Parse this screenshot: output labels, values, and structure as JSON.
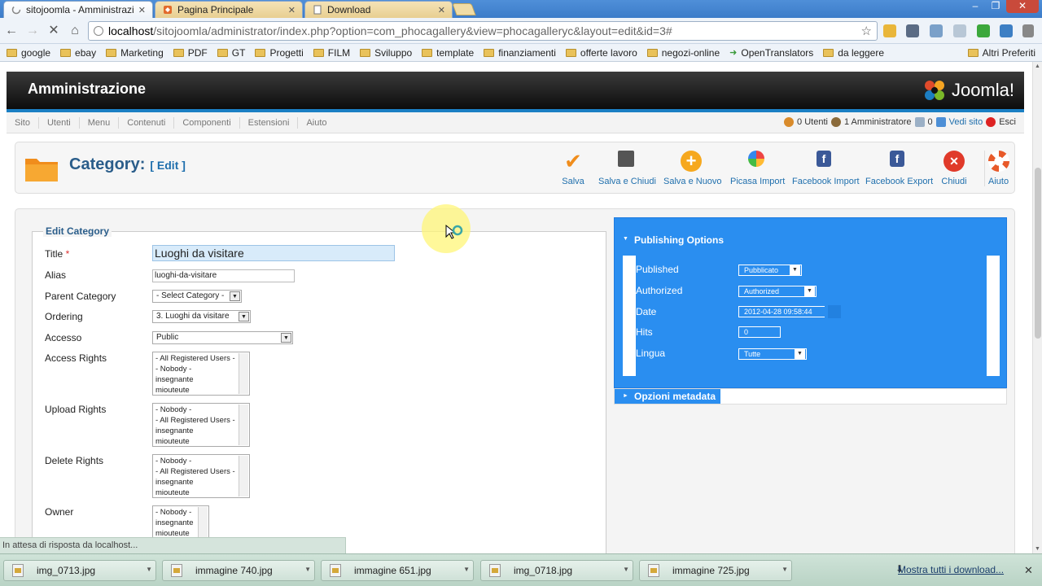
{
  "browser": {
    "tabs": [
      {
        "title": "sitojoomla - Amministrazio",
        "active": true
      },
      {
        "title": "Pagina Principale",
        "active": false
      },
      {
        "title": "Download",
        "active": false
      }
    ],
    "url_host": "localhost",
    "url_path": "/sitojoomla/administrator/index.php?option=com_phocagallery&view=phocagalleryc&layout=edit&id=3#",
    "bookmarks": [
      "google",
      "ebay",
      "Marketing",
      "PDF",
      "GT",
      "Progetti",
      "FILM",
      "Sviluppo",
      "template",
      "finanziamenti",
      "offerte lavoro",
      "negozi-online",
      "OpenTranslators",
      "da leggere"
    ],
    "other_bookmarks": "Altri Preferiti",
    "status": "In attesa di risposta da localhost...",
    "downloads": [
      "img_0713.jpg",
      "immagine 740.jpg",
      "immagine 651.jpg",
      "img_0718.jpg",
      "immagine 725.jpg"
    ],
    "show_all_downloads": "Mostra tutti i download..."
  },
  "admin": {
    "title": "Amministrazione",
    "logo_text": "Joomla!",
    "menu": [
      "Sito",
      "Utenti",
      "Menu",
      "Contenuti",
      "Componenti",
      "Estensioni",
      "Aiuto"
    ],
    "status": {
      "users": "0 Utenti",
      "admins": "1 Amministratore",
      "messages": "0",
      "view_site": "Vedi sito",
      "logout": "Esci"
    }
  },
  "toolbar": {
    "heading": "Category:",
    "heading_edit": "[ Edit ]",
    "buttons": [
      "Salva",
      "Salva e Chiudi",
      "Salva e Nuovo",
      "Picasa Import",
      "Facebook Import",
      "Facebook Export",
      "Chiudi",
      "Aiuto"
    ]
  },
  "form": {
    "legend": "Edit Category",
    "title_label": "Title",
    "required_mark": "*",
    "title_value": "Luoghi da visitare",
    "alias_label": "Alias",
    "alias_value": "luoghi-da-visitare",
    "parent_label": "Parent Category",
    "parent_value": "- Select Category -",
    "ordering_label": "Ordering",
    "ordering_value": "3. Luoghi da visitare",
    "access_label": "Accesso",
    "access_value": "Public",
    "access_rights_label": "Access Rights",
    "access_rights_items": [
      "- All Registered Users -",
      "- Nobody -",
      "insegnante",
      "miouteute"
    ],
    "upload_rights_label": "Upload Rights",
    "upload_rights_items": [
      "- Nobody -",
      "- All Registered Users -",
      "insegnante",
      "miouteute"
    ],
    "delete_rights_label": "Delete Rights",
    "delete_rights_items": [
      "- Nobody -",
      "- All Registered Users -",
      "insegnante",
      "miouteute"
    ],
    "owner_label": "Owner",
    "owner_items": [
      "- Nobody -",
      "insegnante",
      "miouteute"
    ]
  },
  "publishing": {
    "title": "Publishing Options",
    "published_label": "Published",
    "published_value": "Pubblicato",
    "authorized_label": "Authorized",
    "authorized_value": "Authorized",
    "date_label": "Date",
    "date_value": "2012-04-28 09:58:44",
    "hits_label": "Hits",
    "hits_value": "0",
    "lingua_label": "Lingua",
    "lingua_value": "Tutte",
    "meta_title": "Opzioni metadata"
  }
}
